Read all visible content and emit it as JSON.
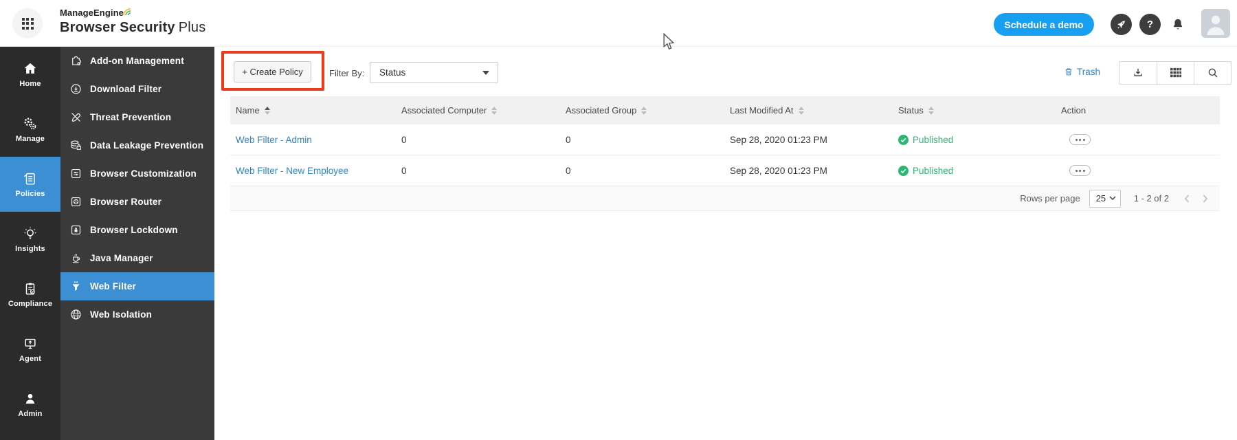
{
  "header": {
    "brand_top": "ManageEngine",
    "brand_main": "Browser Security",
    "brand_suffix": "Plus",
    "demo_button_label": "Schedule a demo"
  },
  "icons": {
    "help_glyph": "?",
    "apps": "grid-3x3",
    "rocket": "rocket",
    "bell": "notification-bell",
    "avatar": "user-photo-placeholder",
    "trash": "trash-can",
    "export": "download-arrow",
    "table_view": "table-grid",
    "search": "magnifier"
  },
  "primary_nav": {
    "active": "Policies",
    "items": [
      {
        "label": "Home",
        "icon": "home-icon"
      },
      {
        "label": "Manage",
        "icon": "gears-icon"
      },
      {
        "label": "Policies",
        "icon": "scroll-icon"
      },
      {
        "label": "Insights",
        "icon": "lightbulb-icon"
      },
      {
        "label": "Compliance",
        "icon": "clipboard-check-icon"
      },
      {
        "label": "Agent",
        "icon": "monitor-upload-icon"
      },
      {
        "label": "Admin",
        "icon": "person-icon"
      }
    ]
  },
  "secondary_nav": {
    "active": "Web Filter",
    "items": [
      {
        "label": "Add-on Management",
        "icon": "puzzle-icon"
      },
      {
        "label": "Download Filter",
        "icon": "download-circle-icon"
      },
      {
        "label": "Threat Prevention",
        "icon": "pencil-slash-icon"
      },
      {
        "label": "Data Leakage Prevention",
        "icon": "database-lock-icon"
      },
      {
        "label": "Browser Customization",
        "icon": "window-sliders-icon"
      },
      {
        "label": "Browser Router",
        "icon": "window-wheel-icon"
      },
      {
        "label": "Browser Lockdown",
        "icon": "window-lock-icon"
      },
      {
        "label": "Java Manager",
        "icon": "coffee-cup-icon"
      },
      {
        "label": "Web Filter",
        "icon": "funnel-icon"
      },
      {
        "label": "Web Isolation",
        "icon": "globe-icon"
      }
    ]
  },
  "toolbar": {
    "create_policy_label": "+ Create Policy",
    "filter_by_label": "Filter By:",
    "filter_value": "Status",
    "trash_label": "Trash"
  },
  "table": {
    "columns": [
      "Name",
      "Associated Computer",
      "Associated Group",
      "Last Modified At",
      "Status",
      "Action"
    ],
    "sorted_column": "Name",
    "rows": [
      {
        "name": "Web Filter - Admin",
        "associated_computer": "0",
        "associated_group": "0",
        "last_modified_at": "Sep 28, 2020 01:23 PM",
        "status": "Published"
      },
      {
        "name": "Web Filter - New Employee",
        "associated_computer": "0",
        "associated_group": "0",
        "last_modified_at": "Sep 28, 2020 01:23 PM",
        "status": "Published"
      }
    ]
  },
  "pagination": {
    "rows_per_page_label": "Rows per page",
    "rows_per_page_value": "25",
    "range_text": "1 - 2 of 2"
  },
  "colors": {
    "accent_blue": "#3b8fd2",
    "demo_button_blue": "#17a0f2",
    "link_blue": "#2e84c6",
    "status_green": "#2bb673",
    "annotation_red": "#ea3b1a",
    "sidebar_dark": "#2b2b2b",
    "sidebar_gray": "#3a3a3a"
  }
}
